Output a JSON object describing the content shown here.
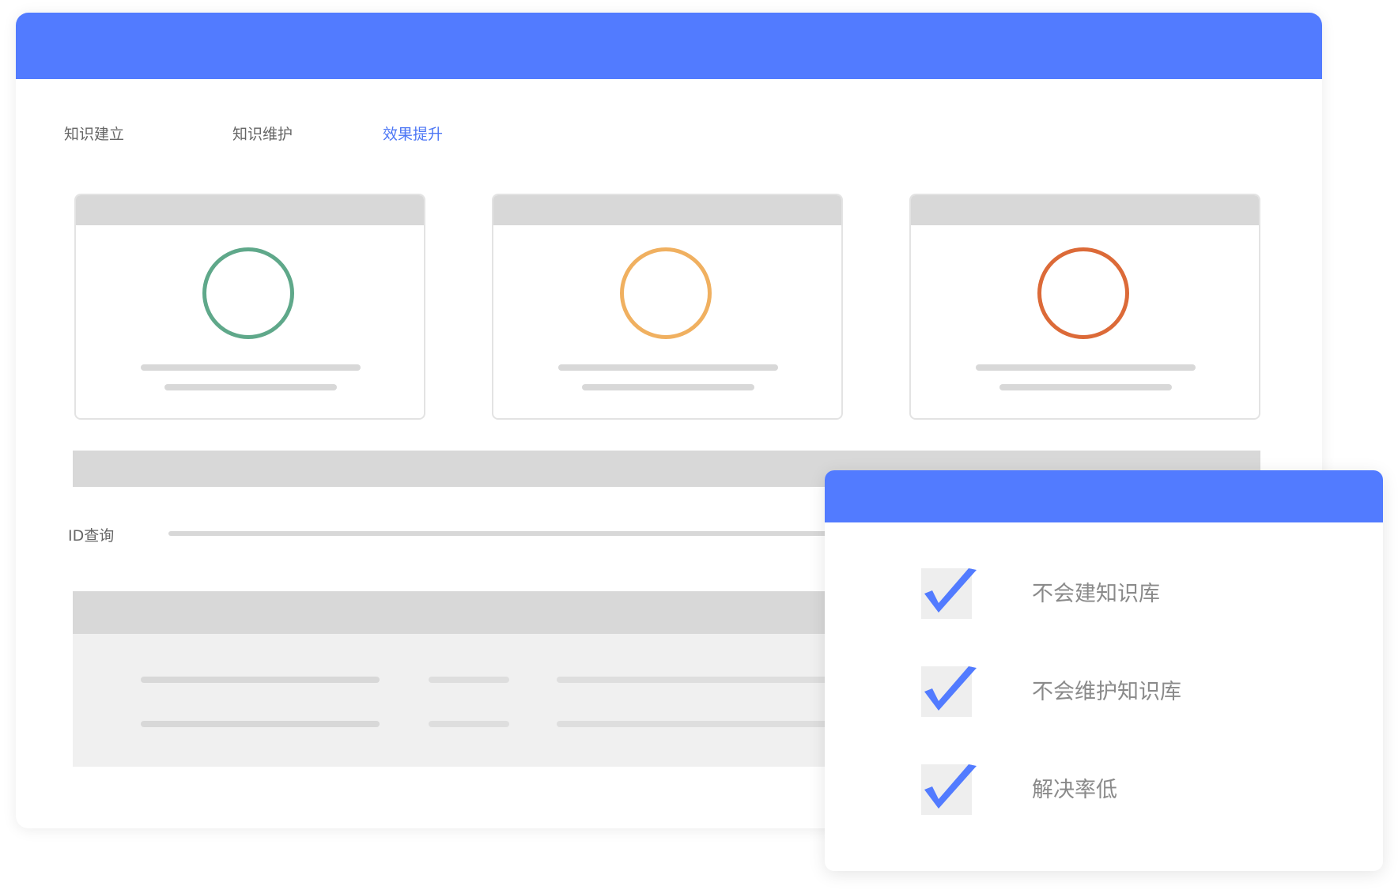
{
  "colors": {
    "accent": "#527bff",
    "tab_text": "#666666",
    "tab_active_text": "#4c76f5",
    "label_text": "#8a8a8a",
    "ring_green": "#5fa88a",
    "ring_orange": "#f0b060",
    "ring_red": "#dc6a38"
  },
  "tabs": [
    {
      "label": "知识建立",
      "active": false
    },
    {
      "label": "知识维护",
      "active": false
    },
    {
      "label": "效果提升",
      "active": true
    }
  ],
  "cards": [
    {
      "ring_color": "#5fa88a"
    },
    {
      "ring_color": "#f0b060"
    },
    {
      "ring_color": "#dc6a38"
    }
  ],
  "id_query": {
    "label": "ID查询"
  },
  "checklist": {
    "icon": "check-icon",
    "items": [
      {
        "label": "不会建知识库",
        "checked": true
      },
      {
        "label": "不会维护知识库",
        "checked": true
      },
      {
        "label": "解决率低",
        "checked": true
      }
    ]
  }
}
